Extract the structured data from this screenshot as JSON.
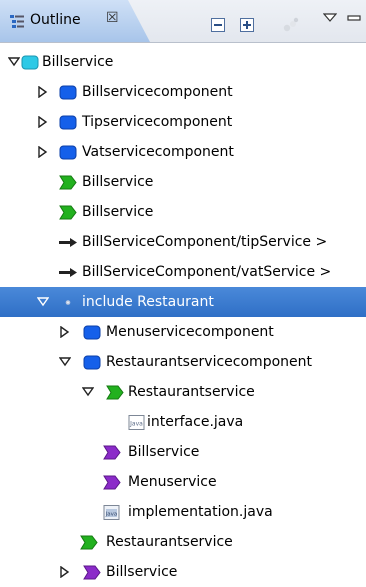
{
  "view": {
    "tab_label": "Outline",
    "tab_close": "☒"
  },
  "colors": {
    "selection": "#3b7bd0",
    "component_blue": "#1560ea",
    "composite_cyan": "#2ec9e6",
    "service_green": "#22b11f",
    "reference_purple": "#8b2bc9"
  },
  "tree": {
    "rows": [
      {
        "label": "Billservice",
        "icon": "composite-icon",
        "twisty": "expanded"
      },
      {
        "label": "Billservicecomponent",
        "icon": "component-icon",
        "twisty": "collapsed"
      },
      {
        "label": "Tipservicecomponent",
        "icon": "component-icon",
        "twisty": "collapsed"
      },
      {
        "label": "Vatservicecomponent",
        "icon": "component-icon",
        "twisty": "collapsed"
      },
      {
        "label": "Billservice",
        "icon": "service-icon",
        "twisty": "none"
      },
      {
        "label": "Billservice",
        "icon": "service-icon",
        "twisty": "none"
      },
      {
        "label": "BillServiceComponent/tipService >",
        "icon": "wire-icon",
        "twisty": "none"
      },
      {
        "label": "BillServiceComponent/vatService >",
        "icon": "wire-icon",
        "twisty": "none"
      },
      {
        "label": "include Restaurant",
        "icon": "include-icon",
        "twisty": "expanded",
        "selected": true
      },
      {
        "label": "Menuservicecomponent",
        "icon": "component-icon",
        "twisty": "collapsed"
      },
      {
        "label": "Restaurantservicecomponent",
        "icon": "component-icon",
        "twisty": "expanded"
      },
      {
        "label": "Restaurantservice",
        "icon": "service-icon",
        "twisty": "expanded"
      },
      {
        "label": "interface.java",
        "icon": "java-file-icon",
        "twisty": "none"
      },
      {
        "label": "Billservice",
        "icon": "reference-icon",
        "twisty": "none"
      },
      {
        "label": "Menuservice",
        "icon": "reference-icon",
        "twisty": "none"
      },
      {
        "label": "implementation.java",
        "icon": "java-impl-icon",
        "twisty": "none"
      },
      {
        "label": "Restaurantservice",
        "icon": "service-icon",
        "twisty": "none"
      },
      {
        "label": "Billservice",
        "icon": "reference-icon",
        "twisty": "collapsed"
      }
    ]
  }
}
